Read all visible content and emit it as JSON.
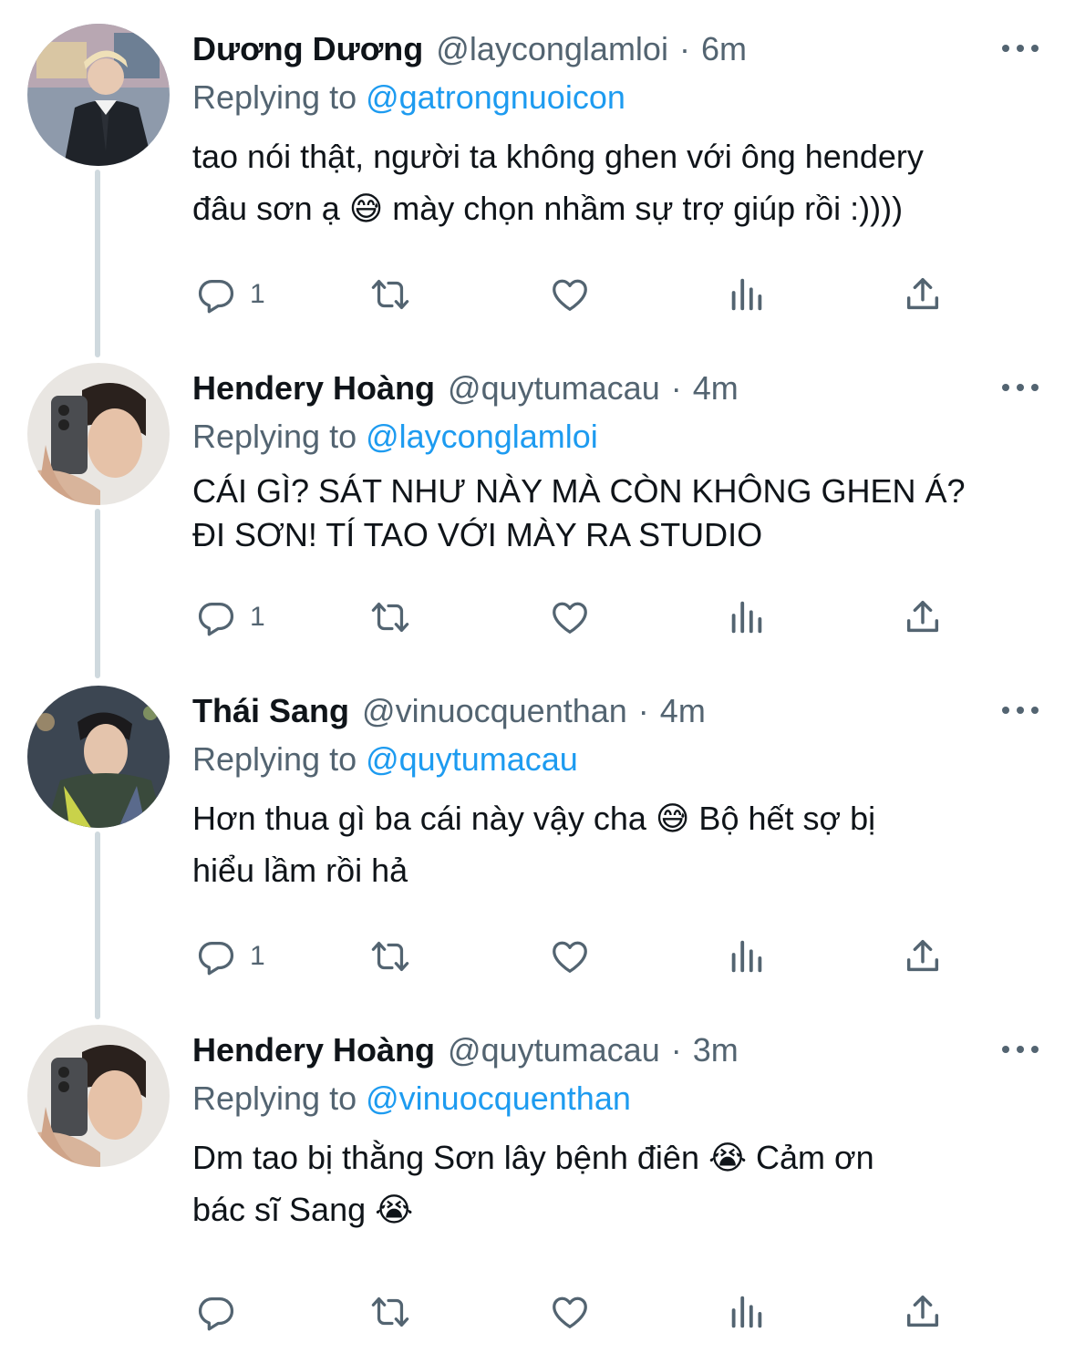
{
  "theme": {
    "link_color": "#1d9bf0",
    "muted_color": "#536471",
    "text_color": "#0f1419",
    "thread_line_color": "#cfd9de"
  },
  "icons": {
    "reply": "reply-icon",
    "retweet": "retweet-icon",
    "like": "heart-icon",
    "views": "views-chart-icon",
    "share": "share-icon",
    "more": "more-icon"
  },
  "tweets": [
    {
      "name": "Dương Dương",
      "handle": "@layconglamloi",
      "separator": "·",
      "time": "6m",
      "replying_prefix": "Replying to ",
      "replying_to": "@gatrongnuoicon",
      "text": "tao nói thật, người ta không ghen với ông hendery\nđâu sơn ạ 😅  mày chọn nhầm sự trợ giúp rồi :))))",
      "reply_count": "1"
    },
    {
      "name": "Hendery Hoàng",
      "handle": "@quytumacau",
      "separator": "·",
      "time": "4m",
      "replying_prefix": "Replying to ",
      "replying_to": "@layconglamloi",
      "text": "CÁI GÌ? SÁT NHƯ NÀY MÀ CÒN KHÔNG GHEN Á?\nĐI SƠN! TÍ TAO VỚI MÀY RA STUDIO",
      "reply_count": "1"
    },
    {
      "name": "Thái Sang",
      "handle": "@vinuocquenthan",
      "separator": "·",
      "time": "4m",
      "replying_prefix": "Replying to ",
      "replying_to": "@quytumacau",
      "text": "Hơn thua gì ba cái này vậy cha 😅  Bộ hết sợ bị\nhiểu lầm rồi hả",
      "reply_count": "1"
    },
    {
      "name": "Hendery Hoàng",
      "handle": "@quytumacau",
      "separator": "·",
      "time": "3m",
      "replying_prefix": "Replying to ",
      "replying_to": "@vinuocquenthan",
      "text": "Dm tao bị thằng Sơn lây bệnh điên 😭  Cảm ơn\nbác sĩ Sang 😭",
      "reply_count": ""
    }
  ]
}
